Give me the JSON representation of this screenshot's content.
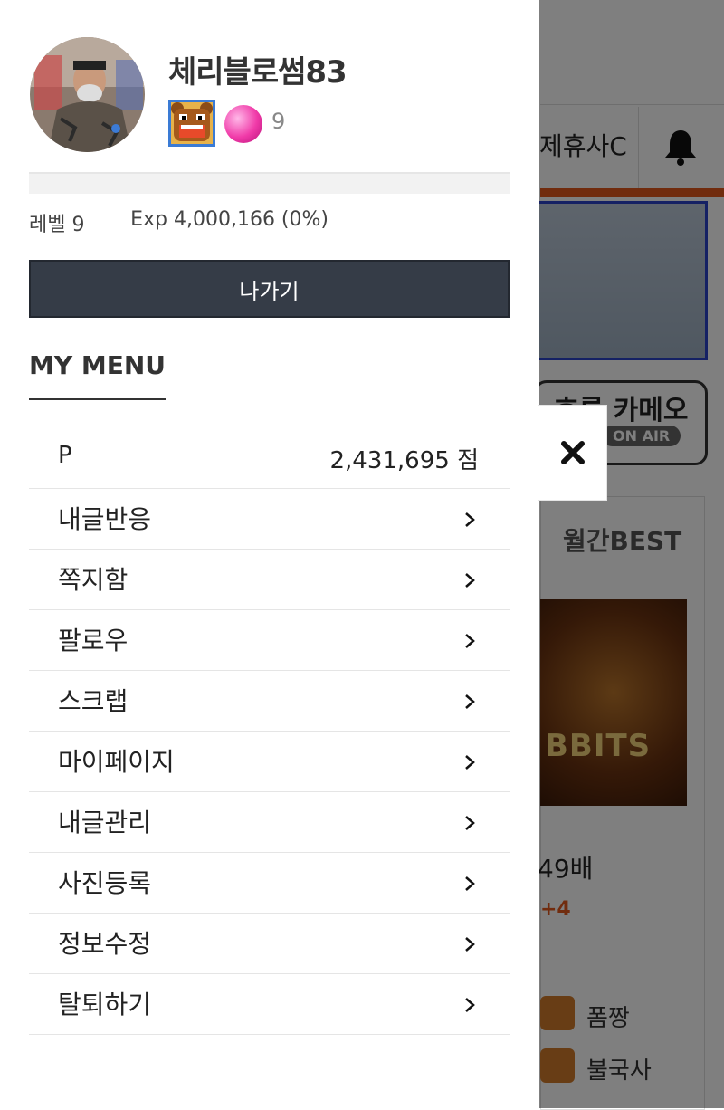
{
  "background_page": {
    "nav_label": "제휴사C",
    "channel_logo": "호롱 카메오",
    "channel_logo_sub": "ON AIR",
    "monthly_best": "월간BEST",
    "game_title": "BBITS",
    "multiplier": "49배",
    "plus": "+4",
    "users": [
      "폼짱",
      "불국사"
    ]
  },
  "profile": {
    "username": "체리블로썸83",
    "badge_icon": "bear-badge-icon",
    "candy_icon": "pink-candy-icon",
    "candy_count": "9",
    "level": "레벨 9",
    "exp": "Exp 4,000,166 (0%)",
    "exp_progress": 0
  },
  "logout_label": "나가기",
  "my_menu": {
    "title": "MY MENU",
    "points": {
      "label": "P",
      "value": "2,431,695 점"
    },
    "items": [
      {
        "label": "내글반응"
      },
      {
        "label": "쪽지함"
      },
      {
        "label": "팔로우"
      },
      {
        "label": "스크랩"
      },
      {
        "label": "마이페이지"
      },
      {
        "label": "내글관리"
      },
      {
        "label": "사진등록"
      },
      {
        "label": "정보수정"
      },
      {
        "label": "탈퇴하기"
      }
    ]
  },
  "close_icon": "close-icon",
  "colors": {
    "accent": "#e2591d",
    "logout_bg": "#353c47",
    "banner_border": "#2b42c9"
  }
}
